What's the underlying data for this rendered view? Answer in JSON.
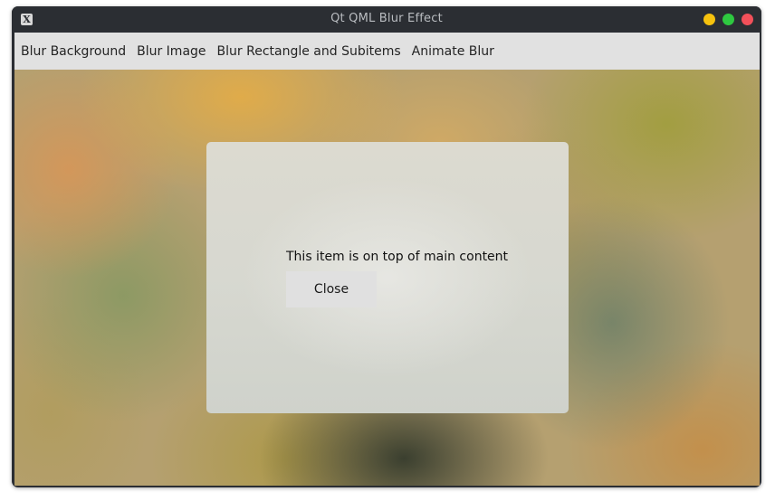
{
  "window": {
    "title": "Qt QML Blur Effect",
    "app_icon_glyph": "X",
    "controls": {
      "minimize_color": "#f6c20e",
      "maximize_color": "#2ec840",
      "close_color": "#f2505a"
    }
  },
  "menubar": {
    "items": [
      {
        "label": "Blur Background"
      },
      {
        "label": "Blur Image"
      },
      {
        "label": "Blur Rectangle and Subitems"
      },
      {
        "label": "Animate Blur"
      }
    ]
  },
  "dialog": {
    "message": "This item is on top of main content",
    "close_label": "Close"
  }
}
